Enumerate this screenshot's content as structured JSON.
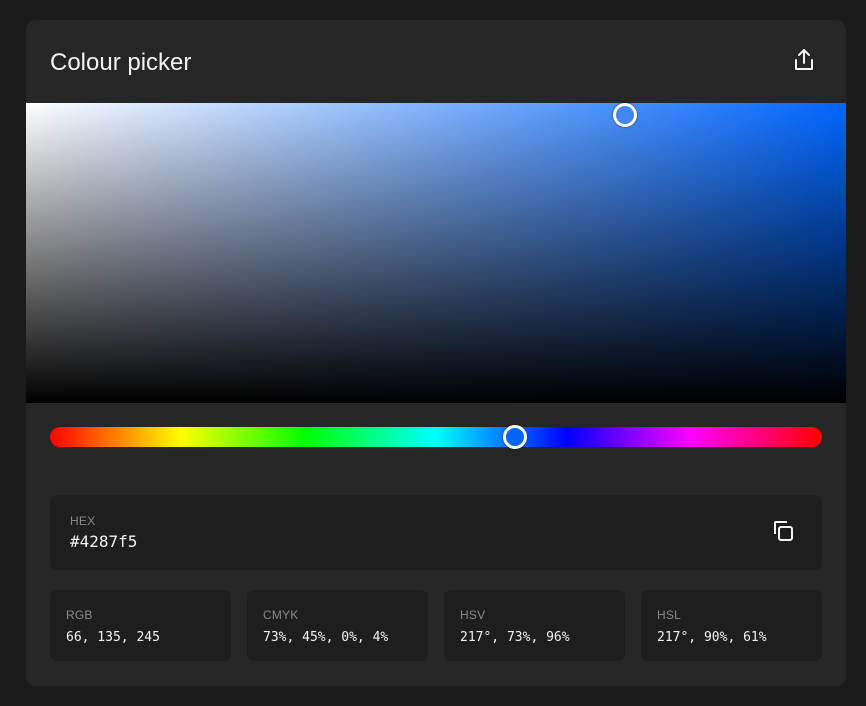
{
  "header": {
    "title": "Colour picker",
    "share_icon": "share-icon"
  },
  "picker": {
    "hue_color": "#0066ff",
    "selected_color": "#4287f5",
    "hue_degrees": 217,
    "saturation_percent": 73,
    "value_percent": 96
  },
  "hex": {
    "label": "HEX",
    "value": "#4287f5",
    "copy_icon": "copy-icon"
  },
  "formats": [
    {
      "label": "RGB",
      "value": "66, 135, 245"
    },
    {
      "label": "CMYK",
      "value": "73%, 45%, 0%, 4%"
    },
    {
      "label": "HSV",
      "value": "217°, 73%, 96%"
    },
    {
      "label": "HSL",
      "value": "217°, 90%, 61%"
    }
  ]
}
